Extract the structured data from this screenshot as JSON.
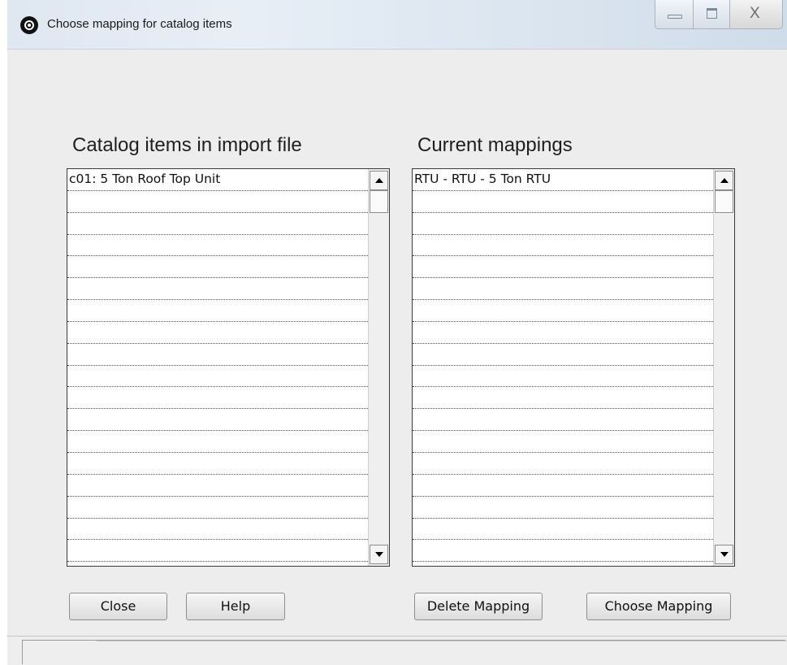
{
  "window": {
    "title": "Choose mapping for catalog items",
    "controls": {
      "minimize": "minimize-icon",
      "maximize": "maximize-icon",
      "close": "X"
    }
  },
  "left_panel": {
    "heading": "Catalog items in import file",
    "items": [
      "c01: 5 Ton Roof Top Unit",
      "",
      "",
      "",
      "",
      "",
      "",
      "",
      "",
      "",
      "",
      "",
      "",
      "",
      "",
      "",
      "",
      ""
    ]
  },
  "right_panel": {
    "heading": "Current mappings",
    "items": [
      "RTU - RTU - 5 Ton RTU",
      "",
      "",
      "",
      "",
      "",
      "",
      "",
      "",
      "",
      "",
      "",
      "",
      "",
      "",
      "",
      "",
      ""
    ]
  },
  "buttons": {
    "close": "Close",
    "help": "Help",
    "delete_mapping": "Delete Mapping",
    "choose_mapping": "Choose Mapping"
  },
  "status": {
    "text": ""
  }
}
